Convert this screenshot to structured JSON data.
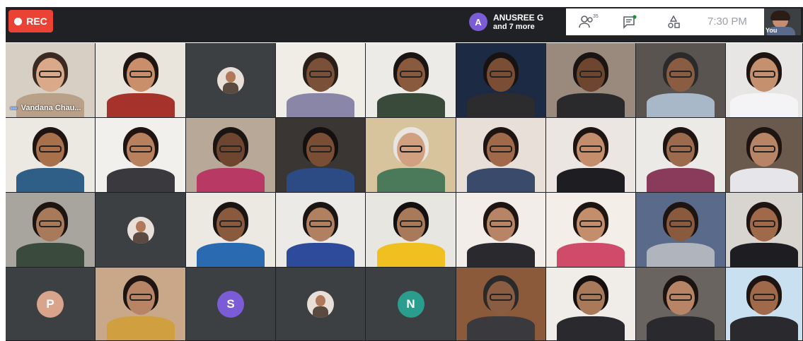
{
  "toolbar": {
    "rec_label": "REC",
    "rec_color": "#ea4335",
    "speaker_initial": "A",
    "speaker_name": "ANUSREE G",
    "speaker_more": "and 7 more",
    "speaker_avatar_color": "#7b5cd6",
    "people_icon": "people-icon",
    "people_count": "35",
    "chat_icon": "chat-icon",
    "activities_icon": "activities-icon",
    "time": "7:30 PM",
    "self_label": "You"
  },
  "participants": {
    "tile_01_name": "Vandana Chau...",
    "tile_20_initial": "P",
    "tile_22_initial": "S",
    "tile_24_initial": "N"
  },
  "colors": {
    "grid_bg": "#202124",
    "avatar_p": "#d9a48c",
    "avatar_s": "#7b5cd6",
    "avatar_n": "#2a9d8f"
  }
}
